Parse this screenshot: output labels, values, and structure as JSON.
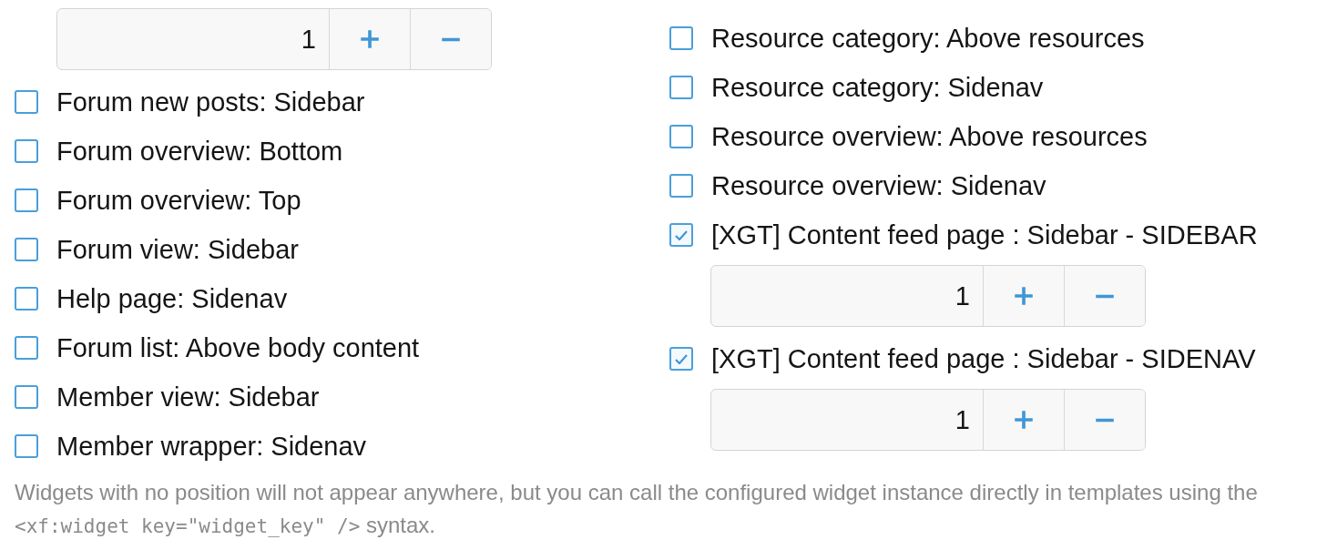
{
  "columns": [
    {
      "items": [
        {
          "kind": "spinner",
          "value": "1"
        },
        {
          "kind": "checkbox",
          "label": "Forum new posts: Sidebar",
          "checked": false
        },
        {
          "kind": "checkbox",
          "label": "Forum overview: Bottom",
          "checked": false
        },
        {
          "kind": "checkbox",
          "label": "Forum overview: Top",
          "checked": false
        },
        {
          "kind": "checkbox",
          "label": "Forum view: Sidebar",
          "checked": false
        },
        {
          "kind": "checkbox",
          "label": "Help page: Sidenav",
          "checked": false
        },
        {
          "kind": "checkbox",
          "label": "Forum list: Above body content",
          "checked": false
        },
        {
          "kind": "checkbox",
          "label": "Member view: Sidebar",
          "checked": false
        },
        {
          "kind": "checkbox",
          "label": "Member wrapper: Sidenav",
          "checked": false
        }
      ]
    },
    {
      "items": [
        {
          "kind": "checkbox",
          "label": "Resource category: Above resources",
          "checked": false
        },
        {
          "kind": "checkbox",
          "label": "Resource category: Sidenav",
          "checked": false
        },
        {
          "kind": "checkbox",
          "label": "Resource overview: Above resources",
          "checked": false
        },
        {
          "kind": "checkbox",
          "label": "Resource overview: Sidenav",
          "checked": false
        },
        {
          "kind": "checkbox",
          "label": "[XGT] Content feed page : Sidebar - SIDEBAR",
          "checked": true
        },
        {
          "kind": "spinner",
          "value": "1"
        },
        {
          "kind": "checkbox",
          "label": "[XGT] Content feed page : Sidebar - SIDENAV",
          "checked": true
        },
        {
          "kind": "spinner",
          "value": "1"
        }
      ]
    }
  ],
  "hint": {
    "before": "Widgets with no position will not appear anywhere, but you can call the configured widget instance directly in templates using the ",
    "code": "<xf:widget key=\"widget_key\" />",
    "after": " syntax."
  }
}
